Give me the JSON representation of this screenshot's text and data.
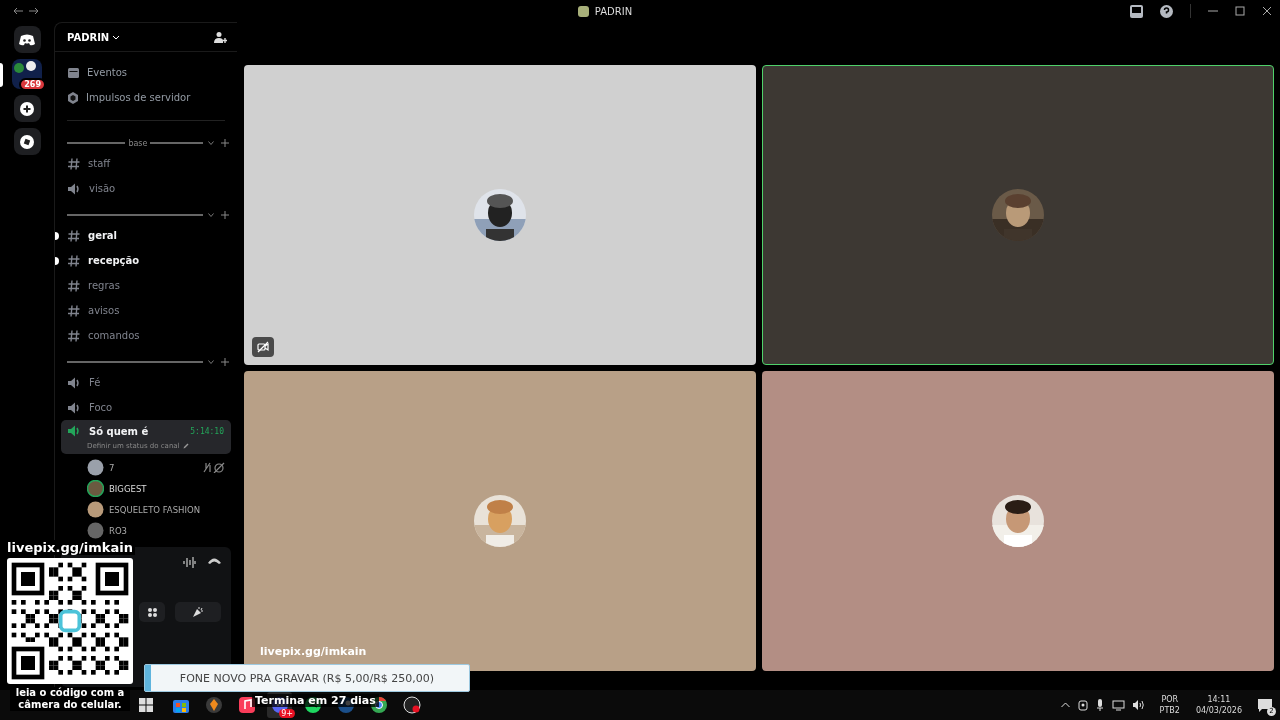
{
  "window": {
    "title": "PADRIN"
  },
  "servers": [
    {
      "kind": "home",
      "selected": false
    },
    {
      "kind": "folder",
      "selected": true,
      "badge": "269"
    },
    {
      "kind": "add",
      "selected": false
    },
    {
      "kind": "discover",
      "selected": false
    }
  ],
  "server": {
    "name": "PADRIN"
  },
  "nav_items": [
    {
      "label": "Eventos",
      "kind": "calendar"
    },
    {
      "label": "Impulsos de servidor",
      "kind": "boost"
    }
  ],
  "categories": [
    {
      "name": "base",
      "channels": [
        {
          "name": "staff",
          "kind": "text",
          "unread": false
        },
        {
          "name": "visão",
          "kind": "voice",
          "unread": false
        }
      ]
    },
    {
      "channels": [
        {
          "name": "geral",
          "kind": "text",
          "unread": true
        },
        {
          "name": "recepção",
          "kind": "text",
          "unread": true
        },
        {
          "name": "regras",
          "kind": "text",
          "unread": false
        },
        {
          "name": "avisos",
          "kind": "text",
          "unread": false
        },
        {
          "name": "comandos",
          "kind": "text",
          "unread": false
        }
      ]
    },
    {
      "channels": [
        {
          "name": "Fé",
          "kind": "voice",
          "unread": false
        },
        {
          "name": "Foco",
          "kind": "voice",
          "unread": false
        },
        {
          "name": "Só quem é",
          "kind": "voice",
          "unread": true,
          "selected": true,
          "timer": "5:14:10",
          "status": "Definir um status do canal"
        }
      ]
    }
  ],
  "members": [
    {
      "name": "7",
      "muted": true,
      "speaking": false
    },
    {
      "name": "BIGGEST",
      "muted": false,
      "speaking": true
    },
    {
      "name": "ESQUELETO FASHION",
      "muted": false,
      "speaking": false
    },
    {
      "name": "RO3",
      "muted": false,
      "speaking": false
    }
  ],
  "tiles": [
    {
      "speaking": false,
      "camera_off": true,
      "color": "#d0d0d0"
    },
    {
      "speaking": true,
      "camera_off": false,
      "color": "#3d3833"
    },
    {
      "speaking": false,
      "camera_off": false,
      "color": "#b8a087"
    },
    {
      "speaking": false,
      "camera_off": false,
      "color": "#b38e84"
    }
  ],
  "overlay": {
    "qr_link": "livepix.gg/imkain",
    "qr_caption": "leia o código com a câmera do celular.",
    "link": "livepix.gg/imkain",
    "goal": "FONE NOVO PRA GRAVAR (R$ 5,00/R$ 250,00)",
    "level": 0.02,
    "ends": "Termina em 27 dias"
  },
  "taskbar": {
    "apps": [
      {
        "kind": "store",
        "selected": false
      },
      {
        "kind": "fl",
        "selected": false
      },
      {
        "kind": "music",
        "selected": false
      },
      {
        "kind": "discord",
        "selected": true,
        "badge": "9+"
      },
      {
        "kind": "spotify",
        "selected": false
      },
      {
        "kind": "steam",
        "selected": false
      },
      {
        "kind": "chrome",
        "selected": false
      },
      {
        "kind": "obs",
        "selected": false
      }
    ],
    "lang": "POR",
    "layout": "PTB2",
    "time": "14:11",
    "date": "04/03/2026",
    "notifications": "2"
  }
}
